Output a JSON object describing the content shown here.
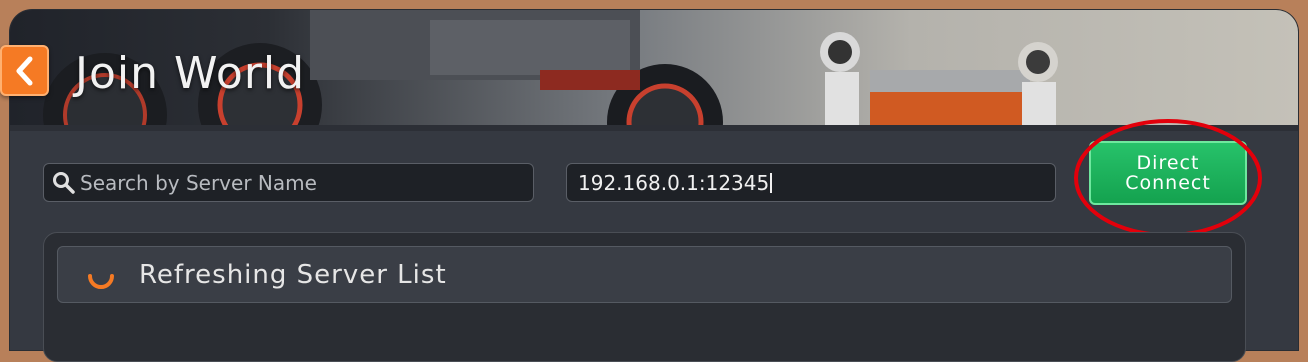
{
  "header": {
    "title": "Join World",
    "back_icon": "chevron-left-icon"
  },
  "search": {
    "placeholder": "Search by Server Name",
    "icon": "search-icon"
  },
  "address_field": {
    "value": "192.168.0.1:12345"
  },
  "direct_connect": {
    "line1": "Direct",
    "line2": "Connect"
  },
  "server_list": {
    "status": "Refreshing Server List",
    "spinner_icon": "loading-spinner-icon"
  },
  "colors": {
    "accent_orange": "#f57a24",
    "connect_green": "#14a24f",
    "highlight_red": "#e3000b"
  }
}
